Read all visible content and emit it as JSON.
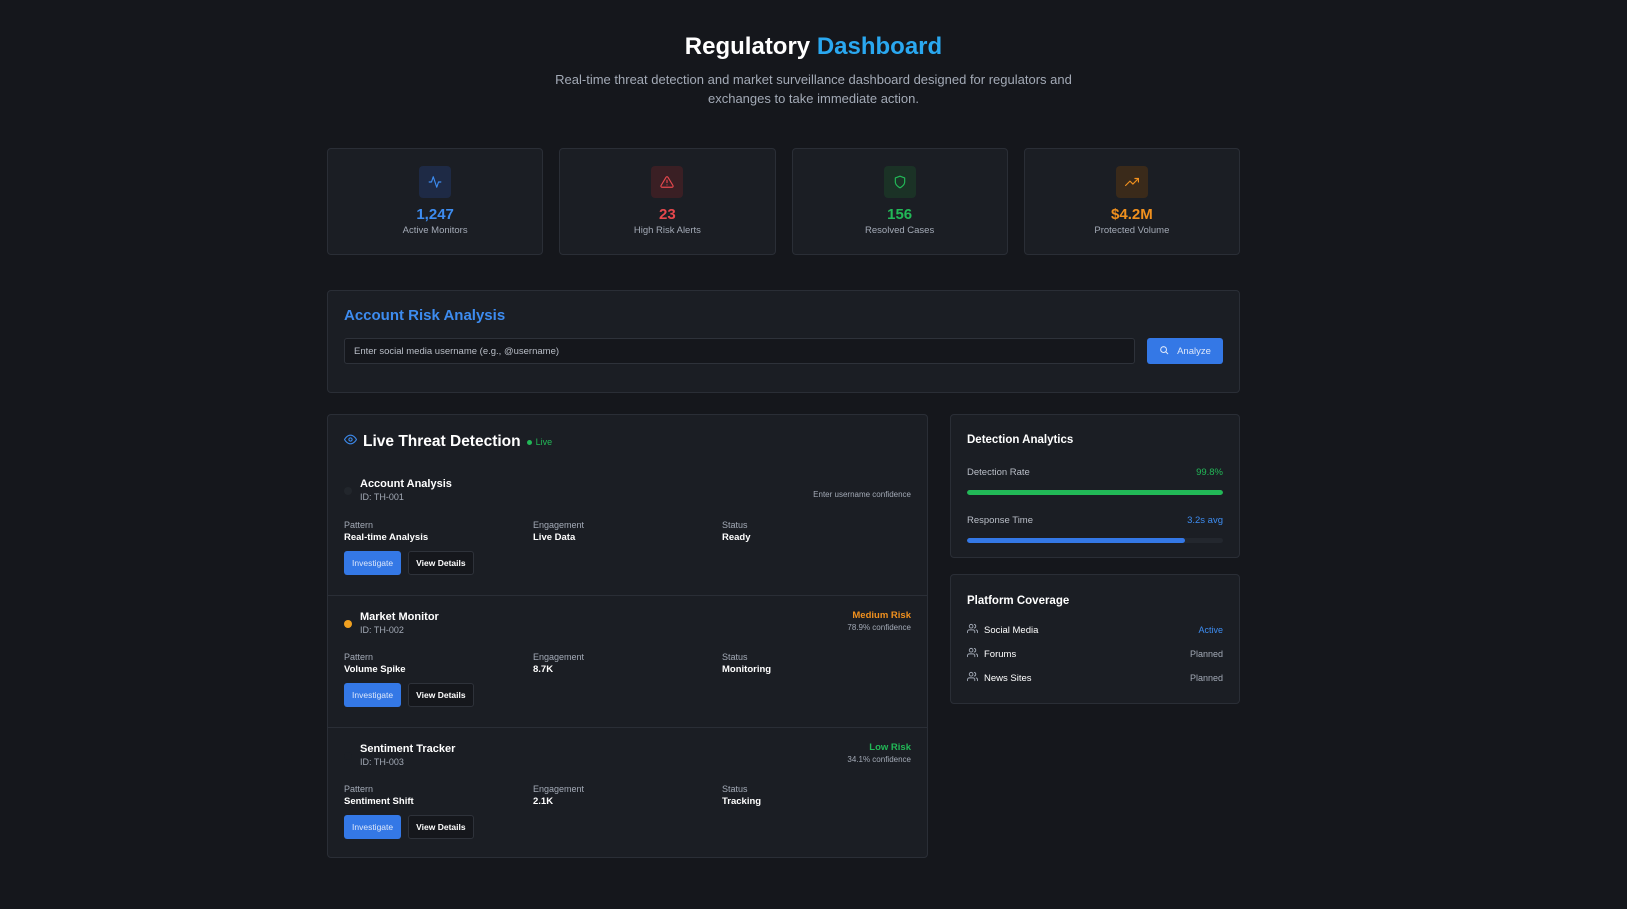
{
  "header": {
    "title_main": "Regulatory",
    "title_accent": "Dashboard",
    "subtitle": "Real-time threat detection and market surveillance dashboard designed for regulators and exchanges to take immediate action."
  },
  "stats": [
    {
      "value": "1,247",
      "label": "Active Monitors",
      "icon": "activity-icon",
      "color": "#3d8cf0"
    },
    {
      "value": "23",
      "label": "High Risk Alerts",
      "icon": "warning-triangle-icon",
      "color": "#e5484d"
    },
    {
      "value": "156",
      "label": "Resolved Cases",
      "icon": "shield-icon",
      "color": "#22b857"
    },
    {
      "value": "$4.2M",
      "label": "Protected Volume",
      "icon": "trending-up-icon",
      "color": "#f0901e"
    }
  ],
  "risk_analysis": {
    "title": "Account Risk Analysis",
    "input_placeholder": "Enter social media username (e.g., @username)",
    "input_value": "",
    "button_label": "Analyze"
  },
  "threats": {
    "title": "Live Threat Detection",
    "live_label": "Live",
    "field_labels": {
      "pattern": "Pattern",
      "engagement": "Engagement",
      "status": "Status"
    },
    "investigate_label": "Investigate",
    "details_label": "View Details",
    "items": [
      {
        "name": "Account Analysis",
        "id": "ID: TH-001",
        "risk": "",
        "confidence": "Enter username confidence",
        "dot_color": "#22262c",
        "risk_color": "#a3aab6",
        "pattern": "Real-time Analysis",
        "engagement": "Live Data",
        "status": "Ready"
      },
      {
        "name": "Market Monitor",
        "id": "ID: TH-002",
        "risk": "Medium Risk",
        "confidence": "78.9% confidence",
        "dot_color": "#f0a020",
        "risk_color": "#f0901e",
        "pattern": "Volume Spike",
        "engagement": "8.7K",
        "status": "Monitoring"
      },
      {
        "name": "Sentiment Tracker",
        "id": "ID: TH-003",
        "risk": "Low Risk",
        "confidence": "34.1% confidence",
        "dot_color": "#1b1e24",
        "risk_color": "#22b857",
        "pattern": "Sentiment Shift",
        "engagement": "2.1K",
        "status": "Tracking"
      }
    ]
  },
  "analytics": {
    "title": "Detection Analytics",
    "metrics": [
      {
        "label": "Detection Rate",
        "value": "99.8%",
        "fill": 1.0,
        "color": "#22b857"
      },
      {
        "label": "Response Time",
        "value": "3.2s avg",
        "fill": 0.85,
        "color": "#3478e6"
      }
    ]
  },
  "coverage": {
    "title": "Platform Coverage",
    "platforms": [
      {
        "name": "Social Media",
        "status": "Active",
        "color": "#3d8cf0"
      },
      {
        "name": "Forums",
        "status": "Planned",
        "color": "#a3aab6"
      },
      {
        "name": "News Sites",
        "status": "Planned",
        "color": "#a3aab6"
      }
    ]
  }
}
